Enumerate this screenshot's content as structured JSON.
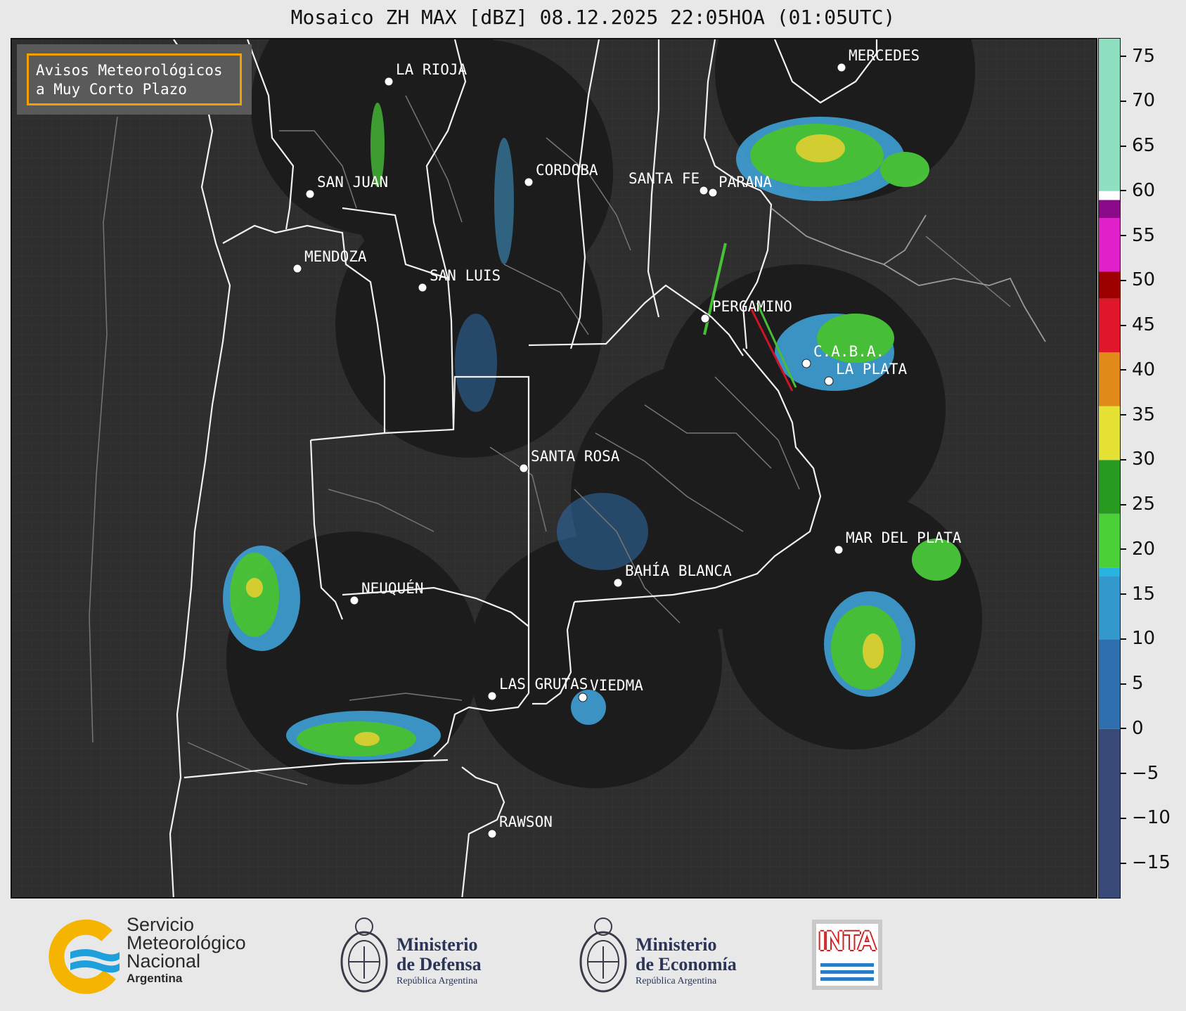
{
  "title": "Mosaico ZH MAX [dBZ] 08.12.2025 22:05HOA (01:05UTC)",
  "warning_box": {
    "line1": "Avisos Meteorológicos",
    "line2": "a Muy Corto Plazo",
    "border_color": "#f5a000"
  },
  "cities": [
    {
      "id": "la-rioja",
      "name": "LA RIOJA"
    },
    {
      "id": "san-juan",
      "name": "SAN JUAN"
    },
    {
      "id": "cordoba",
      "name": "CORDOBA"
    },
    {
      "id": "santa-fe",
      "name": "SANTA FE"
    },
    {
      "id": "parana",
      "name": "PARANA"
    },
    {
      "id": "mercedes",
      "name": "MERCEDES"
    },
    {
      "id": "mendoza",
      "name": "MENDOZA"
    },
    {
      "id": "san-luis",
      "name": "SAN LUIS"
    },
    {
      "id": "pergamino",
      "name": "PERGAMINO"
    },
    {
      "id": "caba",
      "name": "C.A.B.A."
    },
    {
      "id": "la-plata",
      "name": "LA PLATA"
    },
    {
      "id": "santa-rosa",
      "name": "SANTA ROSA"
    },
    {
      "id": "mar-del-plata",
      "name": "MAR DEL PLATA"
    },
    {
      "id": "bahia-blanca",
      "name": "BAHÍA BLANCA"
    },
    {
      "id": "neuquen",
      "name": "NEUQUÉN"
    },
    {
      "id": "las-grutas",
      "name": "LAS GRUTAS"
    },
    {
      "id": "viedma",
      "name": "VIEDMA"
    },
    {
      "id": "rawson",
      "name": "RAWSON"
    }
  ],
  "colorbar": {
    "unit": "dBZ",
    "min": -19,
    "max": 77,
    "ticks": [
      "75",
      "70",
      "65",
      "60",
      "55",
      "50",
      "45",
      "40",
      "35",
      "30",
      "25",
      "20",
      "15",
      "10",
      "5",
      "0",
      "−5",
      "−10",
      "−15"
    ],
    "tick_values": [
      75,
      70,
      65,
      60,
      55,
      50,
      45,
      40,
      35,
      30,
      25,
      20,
      15,
      10,
      5,
      0,
      -5,
      -10,
      -15
    ],
    "bands": [
      {
        "from": -19,
        "to": 0,
        "color": "#3a4a78"
      },
      {
        "from": 0,
        "to": 10,
        "color": "#2f6fae"
      },
      {
        "from": 10,
        "to": 17,
        "color": "#3399cc"
      },
      {
        "from": 17,
        "to": 18,
        "color": "#29b3e0"
      },
      {
        "from": 18,
        "to": 24,
        "color": "#4cd03a"
      },
      {
        "from": 24,
        "to": 30,
        "color": "#279a22"
      },
      {
        "from": 30,
        "to": 36,
        "color": "#e6e235"
      },
      {
        "from": 36,
        "to": 42,
        "color": "#e08a1a"
      },
      {
        "from": 42,
        "to": 48,
        "color": "#e0162a"
      },
      {
        "from": 48,
        "to": 51,
        "color": "#9e0000"
      },
      {
        "from": 51,
        "to": 57,
        "color": "#e020c8"
      },
      {
        "from": 57,
        "to": 59,
        "color": "#8a0a8a"
      },
      {
        "from": 59,
        "to": 60,
        "color": "#ffffff"
      },
      {
        "from": 60,
        "to": 77,
        "color": "#8ee0c0"
      }
    ]
  },
  "footer": {
    "smn": {
      "line1": "Servicio",
      "line2": "Meteorológico",
      "line3": "Nacional",
      "sub": "Argentina"
    },
    "defensa": {
      "line1": "Ministerio",
      "line2": "de Defensa",
      "sub": "República Argentina"
    },
    "economia": {
      "line1": "Ministerio",
      "line2": "de Economía",
      "sub": "República Argentina"
    },
    "inta": {
      "word": "INTA"
    }
  }
}
